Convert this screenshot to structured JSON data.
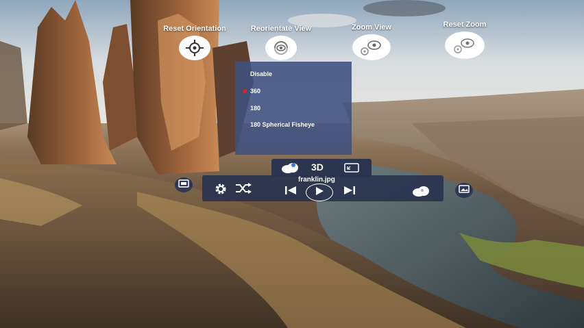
{
  "top_controls": {
    "reset_orientation": "Reset Orientation",
    "reorientate_view": "Reorientate View",
    "zoom_view": "Zoom View",
    "reset_zoom": "Reset Zoom"
  },
  "projection_menu": {
    "items": [
      "Disable",
      "360",
      "180",
      "180 Spherical Fisheye"
    ],
    "selected": "360"
  },
  "mode_bar": {
    "mode_label": "3D"
  },
  "player": {
    "file_name": "franklin.jpg"
  },
  "icons": {
    "reset_orientation": "crosshair-eye-icon",
    "reorientate_view": "rotate-eye-icon",
    "zoom_view": "zoom-eye-icon",
    "reset_zoom": "reset-zoom-eye-icon",
    "settings": "gear-icon",
    "shuffle": "shuffle-icon",
    "previous": "skip-previous-icon",
    "play": "play-icon",
    "next": "skip-next-icon",
    "cloud": "cloud-icon",
    "screen": "screen-size-icon",
    "left_side": "gallery-icon",
    "right_side": "vr-photo-icon"
  },
  "colors": {
    "panel": "#26304e",
    "menu": "#3e5080",
    "selected_dot": "#e02020"
  }
}
